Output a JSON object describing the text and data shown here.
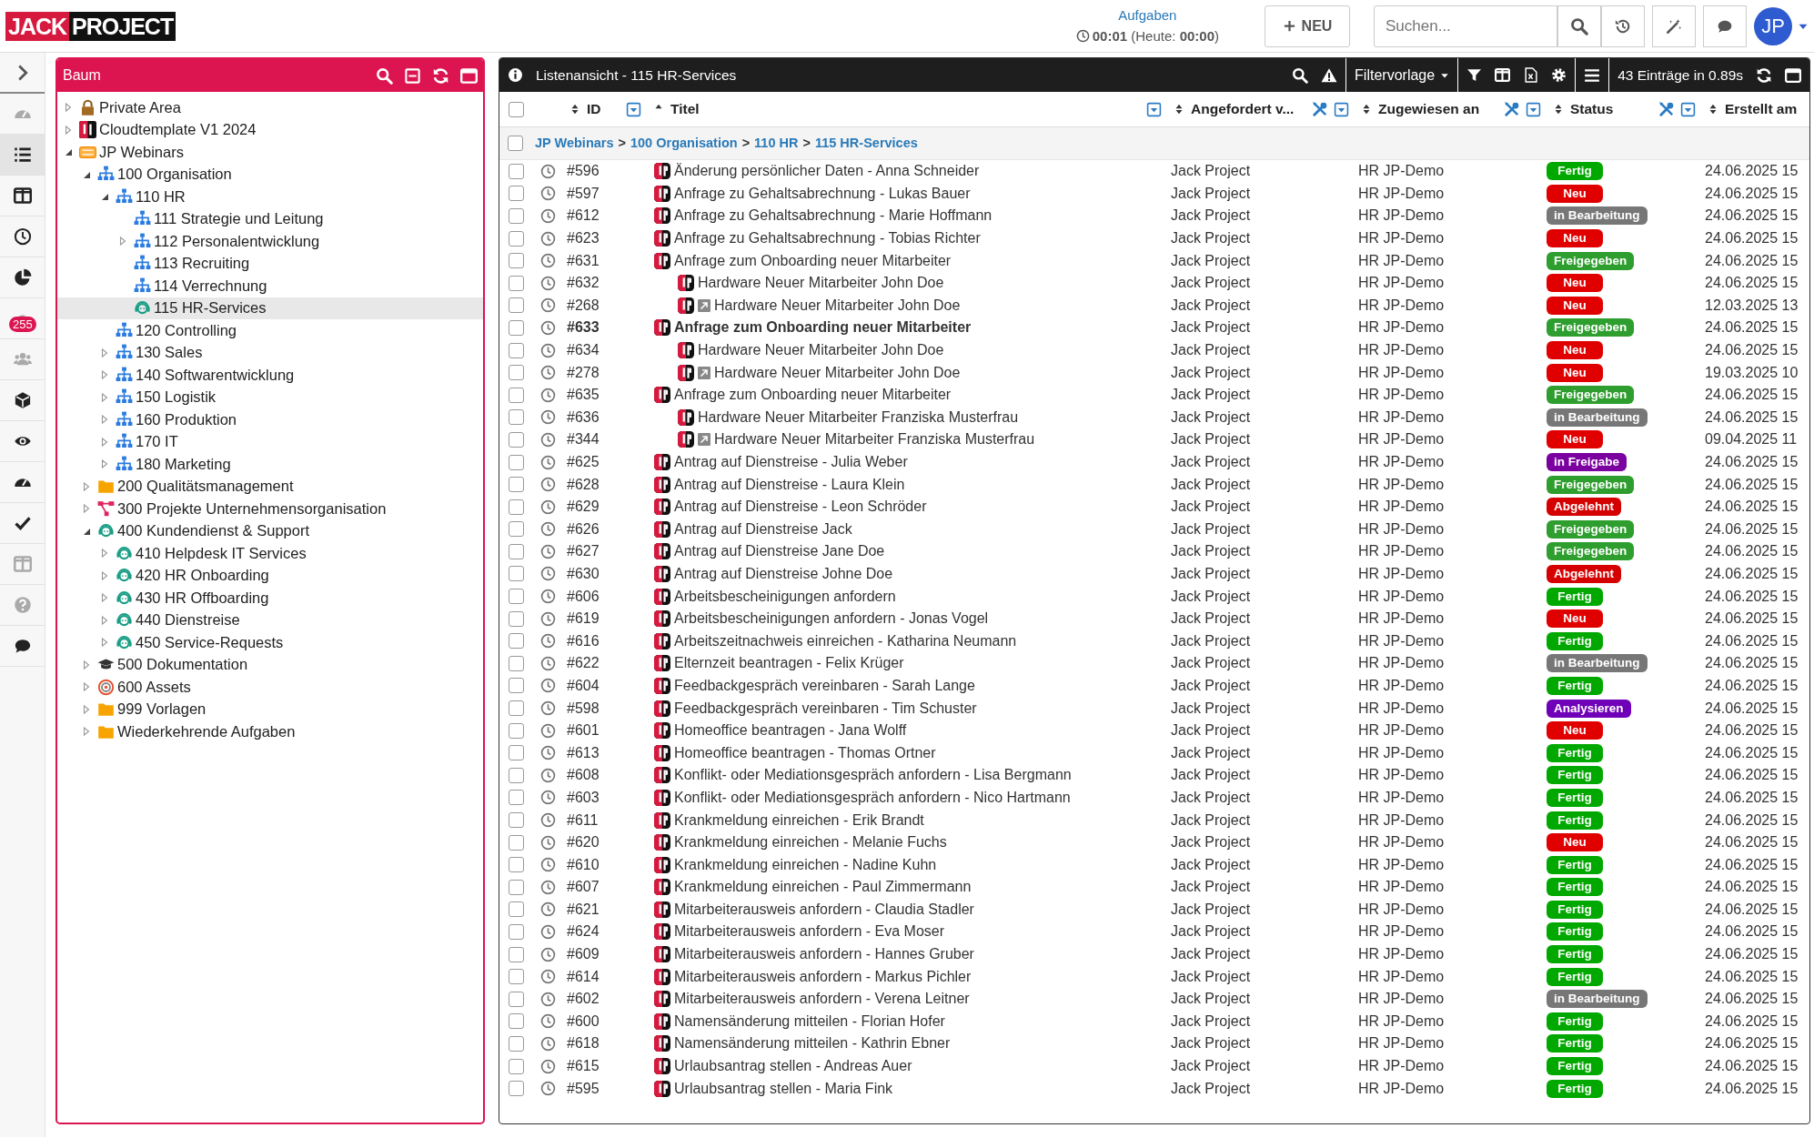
{
  "header": {
    "logo": [
      "JACK",
      "PROJECT"
    ],
    "tasks_link": "Aufgaben",
    "timer": "**00:01** (Heute: **00:00**)",
    "new_button": "NEU",
    "search": {
      "placeholder": "Suchen..."
    },
    "avatar": "JP"
  },
  "rail": [
    {
      "selected": false
    },
    {
      "selected": true
    },
    {
      "selected": false
    },
    {
      "selected": false
    },
    {
      "selected": false
    },
    {
      "selected": false,
      "badge": "255"
    },
    {
      "selected": false
    },
    {
      "selected": false
    },
    {
      "selected": false
    },
    {
      "selected": false
    },
    {
      "selected": false
    },
    {
      "selected": false
    },
    {
      "selected": false
    },
    {
      "selected": false
    }
  ],
  "tree": {
    "title": "Baum",
    "items": [
      {
        "label": "Private Area",
        "kind": "lock",
        "expanded": false,
        "selected": false
      },
      {
        "label": "Cloudtemplate V1 2024",
        "kind": "jp",
        "expanded": false,
        "selected": false
      },
      {
        "label": "JP Webinars",
        "kind": "new",
        "expanded": true,
        "selected": false,
        "children": [
          {
            "label": "100 Organisation",
            "kind": "org",
            "expanded": true,
            "selected": false,
            "children": [
              {
                "label": "110 HR",
                "kind": "org",
                "expanded": true,
                "selected": false,
                "children": [
                  {
                    "label": "111 Strategie und Leitung",
                    "kind": "org",
                    "selected": false
                  },
                  {
                    "label": "112 Personalentwicklung",
                    "kind": "org",
                    "expanded": false,
                    "selected": false
                  },
                  {
                    "label": "113 Recruiting",
                    "kind": "org",
                    "selected": false
                  },
                  {
                    "label": "114 Verrechnung",
                    "kind": "org",
                    "selected": false
                  },
                  {
                    "label": "115 HR-Services",
                    "kind": "headset",
                    "selected": true
                  }
                ]
              },
              {
                "label": "120 Controlling",
                "kind": "org",
                "selected": false
              },
              {
                "label": "130 Sales",
                "kind": "org",
                "expanded": false,
                "selected": false
              },
              {
                "label": "140 Softwarentwicklung",
                "kind": "org",
                "expanded": false,
                "selected": false
              },
              {
                "label": "150 Logistik",
                "kind": "org",
                "expanded": false,
                "selected": false
              },
              {
                "label": "160 Produktion",
                "kind": "org",
                "expanded": false,
                "selected": false
              },
              {
                "label": "170 IT",
                "kind": "org",
                "expanded": false,
                "selected": false
              },
              {
                "label": "180 Marketing",
                "kind": "org",
                "expanded": false,
                "selected": false
              }
            ]
          },
          {
            "label": "200 Qualitätsmanagement",
            "kind": "folder",
            "expanded": false,
            "selected": false
          },
          {
            "label": "300 Projekte Unternehmensorganisation",
            "kind": "network",
            "expanded": false,
            "selected": false
          },
          {
            "label": "400 Kundendienst & Support",
            "kind": "headset",
            "expanded": true,
            "selected": false,
            "children": [
              {
                "label": "410 Helpdesk IT Services",
                "kind": "headset",
                "expanded": false,
                "selected": false
              },
              {
                "label": "420 HR Onboarding",
                "kind": "headset",
                "expanded": false,
                "selected": false
              },
              {
                "label": "430 HR Offboarding",
                "kind": "headset",
                "expanded": false,
                "selected": false
              },
              {
                "label": "440 Dienstreise",
                "kind": "headset",
                "expanded": false,
                "selected": false
              },
              {
                "label": "450 Service-Requests",
                "kind": "headset",
                "expanded": false,
                "selected": false
              }
            ]
          },
          {
            "label": "500 Dokumentation",
            "kind": "cap",
            "expanded": false,
            "selected": false
          },
          {
            "label": "600 Assets",
            "kind": "target",
            "expanded": false,
            "selected": false
          },
          {
            "label": "999 Vorlagen",
            "kind": "folder",
            "expanded": false,
            "selected": false
          },
          {
            "label": "Wiederkehrende Aufgaben",
            "kind": "folder",
            "expanded": false,
            "selected": false
          }
        ]
      }
    ]
  },
  "list": {
    "title": "Listenansicht - 115 HR-Services",
    "filter_template": "Filtervorlage",
    "count": "43 Einträge in 0.89s",
    "select_all": {
      "checked": false
    },
    "columns": [
      {
        "label": "ID",
        "sorted": false,
        "filter": true
      },
      {
        "label": "Titel",
        "sorted": true,
        "filter": true
      },
      {
        "label": "Angefordert v...",
        "sorted": false,
        "filter": true,
        "tools": true
      },
      {
        "label": "Zugewiesen an",
        "sorted": false,
        "filter": true,
        "tools": true
      },
      {
        "label": "Status",
        "sorted": false,
        "filter": true,
        "tools": true
      },
      {
        "label": "Erstellt am",
        "sorted": false
      }
    ],
    "breadcrumb": {
      "checked": false,
      "items": [
        {
          "label": "JP Webinars",
          "kind": "link"
        },
        {
          "label": ">",
          "kind": "separator"
        },
        {
          "label": "100 Organisation",
          "kind": "link"
        },
        {
          "label": ">",
          "kind": "separator"
        },
        {
          "label": "110 HR",
          "kind": "link"
        },
        {
          "label": ">",
          "kind": "separator"
        },
        {
          "label": "115 HR-Services",
          "kind": "link"
        }
      ]
    },
    "rows": [
      {
        "id": "#596",
        "title": "Änderung persönlicher Daten - Anna Schneider",
        "bold": false,
        "checked": false,
        "requester": "Jack Project",
        "assignee": "HR JP-Demo",
        "status": {
          "label": "Fertig",
          "color": "#00a800"
        },
        "created": "24.06.2025 15"
      },
      {
        "id": "#597",
        "title": "Anfrage zu Gehaltsabrechnung - Lukas Bauer",
        "bold": false,
        "checked": false,
        "requester": "Jack Project",
        "assignee": "HR JP-Demo",
        "status": {
          "label": "Neu",
          "color": "#e00000"
        },
        "created": "24.06.2025 15"
      },
      {
        "id": "#612",
        "title": "Anfrage zu Gehaltsabrechnung - Marie Hoffmann",
        "bold": false,
        "checked": false,
        "requester": "Jack Project",
        "assignee": "HR JP-Demo",
        "status": {
          "label": "in Bearbeitung",
          "color": "#777777"
        },
        "created": "24.06.2025 15"
      },
      {
        "id": "#623",
        "title": "Anfrage zu Gehaltsabrechnung - Tobias Richter",
        "bold": false,
        "checked": false,
        "requester": "Jack Project",
        "assignee": "HR JP-Demo",
        "status": {
          "label": "Neu",
          "color": "#e00000"
        },
        "created": "24.06.2025 15"
      },
      {
        "id": "#631",
        "title": "Anfrage zum Onboarding neuer Mitarbeiter",
        "bold": false,
        "checked": false,
        "requester": "Jack Project",
        "assignee": "HR JP-Demo",
        "status": {
          "label": "Freigegeben",
          "color": "#2e9e2e"
        },
        "created": "24.06.2025 15",
        "children": [
          {
            "id": "#632",
            "title": "Hardware Neuer Mitarbeiter John Doe",
            "bold": false,
            "checked": false,
            "requester": "Jack Project",
            "assignee": "HR JP-Demo",
            "status": {
              "label": "Neu",
              "color": "#e00000"
            },
            "created": "24.06.2025 15"
          },
          {
            "id": "#268",
            "title": "Hardware Neuer Mitarbeiter John Doe",
            "link": true,
            "bold": false,
            "checked": false,
            "requester": "Jack Project",
            "assignee": "HR JP-Demo",
            "status": {
              "label": "Neu",
              "color": "#e00000"
            },
            "created": "12.03.2025 13"
          }
        ]
      },
      {
        "id": "#633",
        "title": "Anfrage zum Onboarding neuer Mitarbeiter",
        "bold": true,
        "checked": false,
        "requester": "Jack Project",
        "assignee": "HR JP-Demo",
        "status": {
          "label": "Freigegeben",
          "color": "#2e9e2e"
        },
        "created": "24.06.2025 15",
        "children": [
          {
            "id": "#634",
            "title": "Hardware Neuer Mitarbeiter John Doe",
            "bold": false,
            "checked": false,
            "requester": "Jack Project",
            "assignee": "HR JP-Demo",
            "status": {
              "label": "Neu",
              "color": "#e00000"
            },
            "created": "24.06.2025 15"
          },
          {
            "id": "#278",
            "title": "Hardware Neuer Mitarbeiter John Doe",
            "link": true,
            "bold": false,
            "checked": false,
            "requester": "Jack Project",
            "assignee": "HR JP-Demo",
            "status": {
              "label": "Neu",
              "color": "#e00000"
            },
            "created": "19.03.2025 10"
          }
        ]
      },
      {
        "id": "#635",
        "title": "Anfrage zum Onboarding neuer Mitarbeiter",
        "bold": false,
        "checked": false,
        "requester": "Jack Project",
        "assignee": "HR JP-Demo",
        "status": {
          "label": "Freigegeben",
          "color": "#2e9e2e"
        },
        "created": "24.06.2025 15",
        "children": [
          {
            "id": "#636",
            "title": "Hardware Neuer Mitarbeiter Franziska Musterfrau",
            "bold": false,
            "checked": false,
            "requester": "Jack Project",
            "assignee": "HR JP-Demo",
            "status": {
              "label": "in Bearbeitung",
              "color": "#777777"
            },
            "created": "24.06.2025 15"
          },
          {
            "id": "#344",
            "title": "Hardware Neuer Mitarbeiter Franziska Musterfrau",
            "link": true,
            "bold": false,
            "checked": false,
            "requester": "Jack Project",
            "assignee": "HR JP-Demo",
            "status": {
              "label": "Neu",
              "color": "#e00000"
            },
            "created": "09.04.2025 11"
          }
        ]
      },
      {
        "id": "#625",
        "title": "Antrag auf Dienstreise - Julia Weber",
        "bold": false,
        "checked": false,
        "requester": "Jack Project",
        "assignee": "HR JP-Demo",
        "status": {
          "label": "in Freigabe",
          "color": "#7a00a0"
        },
        "created": "24.06.2025 15"
      },
      {
        "id": "#628",
        "title": "Antrag auf Dienstreise - Laura Klein",
        "bold": false,
        "checked": false,
        "requester": "Jack Project",
        "assignee": "HR JP-Demo",
        "status": {
          "label": "Freigegeben",
          "color": "#2e9e2e"
        },
        "created": "24.06.2025 15"
      },
      {
        "id": "#629",
        "title": "Antrag auf Dienstreise - Leon Schröder",
        "bold": false,
        "checked": false,
        "requester": "Jack Project",
        "assignee": "HR JP-Demo",
        "status": {
          "label": "Abgelehnt",
          "color": "#d50000"
        },
        "created": "24.06.2025 15"
      },
      {
        "id": "#626",
        "title": "Antrag auf Dienstreise Jack",
        "bold": false,
        "checked": false,
        "requester": "Jack Project",
        "assignee": "HR JP-Demo",
        "status": {
          "label": "Freigegeben",
          "color": "#2e9e2e"
        },
        "created": "24.06.2025 15"
      },
      {
        "id": "#627",
        "title": "Antrag auf Dienstreise Jane Doe",
        "bold": false,
        "checked": false,
        "requester": "Jack Project",
        "assignee": "HR JP-Demo",
        "status": {
          "label": "Freigegeben",
          "color": "#2e9e2e"
        },
        "created": "24.06.2025 15"
      },
      {
        "id": "#630",
        "title": "Antrag auf Dienstreise Johne Doe",
        "bold": false,
        "checked": false,
        "requester": "Jack Project",
        "assignee": "HR JP-Demo",
        "status": {
          "label": "Abgelehnt",
          "color": "#d50000"
        },
        "created": "24.06.2025 15"
      },
      {
        "id": "#606",
        "title": "Arbeitsbescheinigungen anfordern",
        "bold": false,
        "checked": false,
        "requester": "Jack Project",
        "assignee": "HR JP-Demo",
        "status": {
          "label": "Fertig",
          "color": "#00a800"
        },
        "created": "24.06.2025 15"
      },
      {
        "id": "#619",
        "title": "Arbeitsbescheinigungen anfordern - Jonas Vogel",
        "bold": false,
        "checked": false,
        "requester": "Jack Project",
        "assignee": "HR JP-Demo",
        "status": {
          "label": "Neu",
          "color": "#e00000"
        },
        "created": "24.06.2025 15"
      },
      {
        "id": "#616",
        "title": "Arbeitszeitnachweis einreichen - Katharina Neumann",
        "bold": false,
        "checked": false,
        "requester": "Jack Project",
        "assignee": "HR JP-Demo",
        "status": {
          "label": "Fertig",
          "color": "#00a800"
        },
        "created": "24.06.2025 15"
      },
      {
        "id": "#622",
        "title": "Elternzeit beantragen - Felix Krüger",
        "bold": false,
        "checked": false,
        "requester": "Jack Project",
        "assignee": "HR JP-Demo",
        "status": {
          "label": "in Bearbeitung",
          "color": "#777777"
        },
        "created": "24.06.2025 15"
      },
      {
        "id": "#604",
        "title": "Feedbackgespräch vereinbaren - Sarah Lange",
        "bold": false,
        "checked": false,
        "requester": "Jack Project",
        "assignee": "HR JP-Demo",
        "status": {
          "label": "Fertig",
          "color": "#00a800"
        },
        "created": "24.06.2025 15"
      },
      {
        "id": "#598",
        "title": "Feedbackgespräch vereinbaren - Tim Schuster",
        "bold": false,
        "checked": false,
        "requester": "Jack Project",
        "assignee": "HR JP-Demo",
        "status": {
          "label": "Analysieren",
          "color": "#7000b8"
        },
        "created": "24.06.2025 15"
      },
      {
        "id": "#601",
        "title": "Homeoffice beantragen - Jana Wolff",
        "bold": false,
        "checked": false,
        "requester": "Jack Project",
        "assignee": "HR JP-Demo",
        "status": {
          "label": "Neu",
          "color": "#e00000"
        },
        "created": "24.06.2025 15"
      },
      {
        "id": "#613",
        "title": "Homeoffice beantragen - Thomas Ortner",
        "bold": false,
        "checked": false,
        "requester": "Jack Project",
        "assignee": "HR JP-Demo",
        "status": {
          "label": "Fertig",
          "color": "#00a800"
        },
        "created": "24.06.2025 15"
      },
      {
        "id": "#608",
        "title": "Konflikt- oder Mediationsgespräch anfordern - Lisa Bergmann",
        "bold": false,
        "checked": false,
        "requester": "Jack Project",
        "assignee": "HR JP-Demo",
        "status": {
          "label": "Fertig",
          "color": "#00a800"
        },
        "created": "24.06.2025 15"
      },
      {
        "id": "#603",
        "title": "Konflikt- oder Mediationsgespräch anfordern - Nico Hartmann",
        "bold": false,
        "checked": false,
        "requester": "Jack Project",
        "assignee": "HR JP-Demo",
        "status": {
          "label": "Fertig",
          "color": "#00a800"
        },
        "created": "24.06.2025 15"
      },
      {
        "id": "#611",
        "title": "Krankmeldung einreichen - Erik Brandt",
        "bold": false,
        "checked": false,
        "requester": "Jack Project",
        "assignee": "HR JP-Demo",
        "status": {
          "label": "Fertig",
          "color": "#00a800"
        },
        "created": "24.06.2025 15"
      },
      {
        "id": "#620",
        "title": "Krankmeldung einreichen - Melanie Fuchs",
        "bold": false,
        "checked": false,
        "requester": "Jack Project",
        "assignee": "HR JP-Demo",
        "status": {
          "label": "Neu",
          "color": "#e00000"
        },
        "created": "24.06.2025 15"
      },
      {
        "id": "#610",
        "title": "Krankmeldung einreichen - Nadine Kuhn",
        "bold": false,
        "checked": false,
        "requester": "Jack Project",
        "assignee": "HR JP-Demo",
        "status": {
          "label": "Fertig",
          "color": "#00a800"
        },
        "created": "24.06.2025 15"
      },
      {
        "id": "#607",
        "title": "Krankmeldung einreichen - Paul Zimmermann",
        "bold": false,
        "checked": false,
        "requester": "Jack Project",
        "assignee": "HR JP-Demo",
        "status": {
          "label": "Fertig",
          "color": "#00a800"
        },
        "created": "24.06.2025 15"
      },
      {
        "id": "#621",
        "title": "Mitarbeiterausweis anfordern - Claudia Stadler",
        "bold": false,
        "checked": false,
        "requester": "Jack Project",
        "assignee": "HR JP-Demo",
        "status": {
          "label": "Fertig",
          "color": "#00a800"
        },
        "created": "24.06.2025 15"
      },
      {
        "id": "#624",
        "title": "Mitarbeiterausweis anfordern - Eva Moser",
        "bold": false,
        "checked": false,
        "requester": "Jack Project",
        "assignee": "HR JP-Demo",
        "status": {
          "label": "Fertig",
          "color": "#00a800"
        },
        "created": "24.06.2025 15"
      },
      {
        "id": "#609",
        "title": "Mitarbeiterausweis anfordern - Hannes Gruber",
        "bold": false,
        "checked": false,
        "requester": "Jack Project",
        "assignee": "HR JP-Demo",
        "status": {
          "label": "Fertig",
          "color": "#00a800"
        },
        "created": "24.06.2025 15"
      },
      {
        "id": "#614",
        "title": "Mitarbeiterausweis anfordern - Markus Pichler",
        "bold": false,
        "checked": false,
        "requester": "Jack Project",
        "assignee": "HR JP-Demo",
        "status": {
          "label": "Fertig",
          "color": "#00a800"
        },
        "created": "24.06.2025 15"
      },
      {
        "id": "#602",
        "title": "Mitarbeiterausweis anfordern - Verena Leitner",
        "bold": false,
        "checked": false,
        "requester": "Jack Project",
        "assignee": "HR JP-Demo",
        "status": {
          "label": "in Bearbeitung",
          "color": "#777777"
        },
        "created": "24.06.2025 15"
      },
      {
        "id": "#600",
        "title": "Namensänderung mitteilen - Florian Hofer",
        "bold": false,
        "checked": false,
        "requester": "Jack Project",
        "assignee": "HR JP-Demo",
        "status": {
          "label": "Fertig",
          "color": "#00a800"
        },
        "created": "24.06.2025 15"
      },
      {
        "id": "#618",
        "title": "Namensänderung mitteilen - Kathrin Ebner",
        "bold": false,
        "checked": false,
        "requester": "Jack Project",
        "assignee": "HR JP-Demo",
        "status": {
          "label": "Fertig",
          "color": "#00a800"
        },
        "created": "24.06.2025 15"
      },
      {
        "id": "#615",
        "title": "Urlaubsantrag stellen - Andreas Auer",
        "bold": false,
        "checked": false,
        "requester": "Jack Project",
        "assignee": "HR JP-Demo",
        "status": {
          "label": "Fertig",
          "color": "#00a800"
        },
        "created": "24.06.2025 15"
      },
      {
        "id": "#595",
        "title": "Urlaubsantrag stellen - Maria Fink",
        "bold": false,
        "checked": false,
        "requester": "Jack Project",
        "assignee": "HR JP-Demo",
        "status": {
          "label": "Fertig",
          "color": "#00a800"
        },
        "created": "24.06.2025 15"
      }
    ]
  }
}
